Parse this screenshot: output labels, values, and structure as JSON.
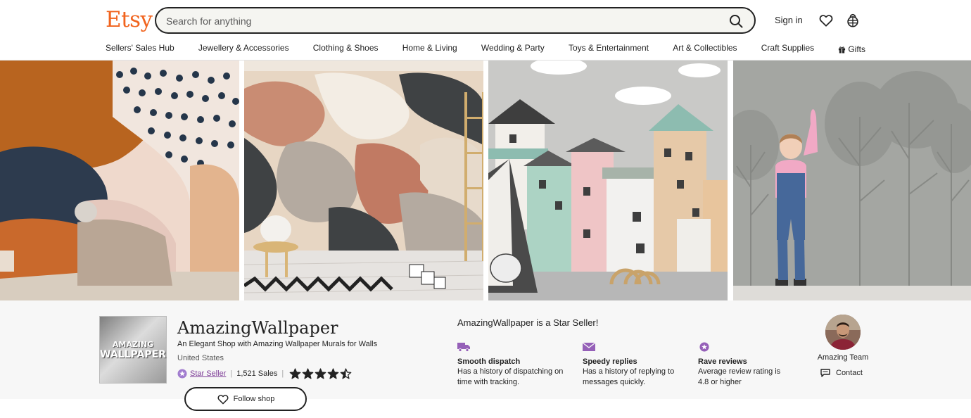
{
  "header": {
    "logo": "Etsy",
    "search_placeholder": "Search for anything",
    "signin": "Sign in",
    "icons": [
      "search-icon",
      "heart-icon",
      "cart-icon"
    ]
  },
  "nav": [
    "Sellers' Sales Hub",
    "Jewellery & Accessories",
    "Clothing & Shoes",
    "Home & Living",
    "Wedding & Party",
    "Toys & Entertainment",
    "Art & Collectibles",
    "Craft Supplies",
    "Gifts"
  ],
  "shop": {
    "logo_line1": "AMAZING",
    "logo_line2": "WALLPAPER",
    "name": "AmazingWallpaper",
    "tagline": "An Elegant Shop with Amazing Wallpaper Murals for Walls",
    "location": "United States",
    "star_seller": "Star Seller",
    "sales": "1,521 Sales",
    "rating": 4.5,
    "follow": "Follow shop"
  },
  "star_seller": {
    "heading": "AmazingWallpaper is a Star Seller!",
    "features": [
      {
        "title": "Smooth dispatch",
        "desc": "Has a history of dispatching on time with tracking."
      },
      {
        "title": "Speedy replies",
        "desc": "Has a history of replying to messages quickly."
      },
      {
        "title": "Rave reviews",
        "desc": "Average review rating is 4.8 or higher"
      }
    ]
  },
  "owner": {
    "name": "Amazing Team",
    "contact": "Contact"
  },
  "colors": {
    "brand": "#f1641e",
    "star_seller": "#7f3e98",
    "text": "#222222"
  }
}
